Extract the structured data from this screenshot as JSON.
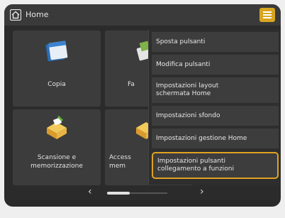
{
  "header": {
    "title": "Home",
    "home_icon": "home-icon",
    "menu_icon": "menu-icon",
    "accent": "#d7a51f"
  },
  "tiles": [
    {
      "label": "Copia",
      "icon": "copy-icon"
    },
    {
      "label": "Fa",
      "icon": "fax-icon"
    },
    {
      "label": "Scansione e\nmemorizzazione",
      "icon": "scan-store-icon"
    },
    {
      "label": "Access\nmem",
      "icon": "access-stored-icon"
    }
  ],
  "pager": {
    "prev": "‹",
    "next": "›"
  },
  "menu": {
    "items": [
      "Sposta pulsanti",
      "Modifica pulsanti",
      "Impostazioni layout\nschermata Home",
      "Impostazioni sfondo",
      "Impostazioni gestione Home",
      "Impostazioni pulsanti\ncollegamento a funzioni"
    ],
    "highlight_color": "#e0a21e"
  }
}
